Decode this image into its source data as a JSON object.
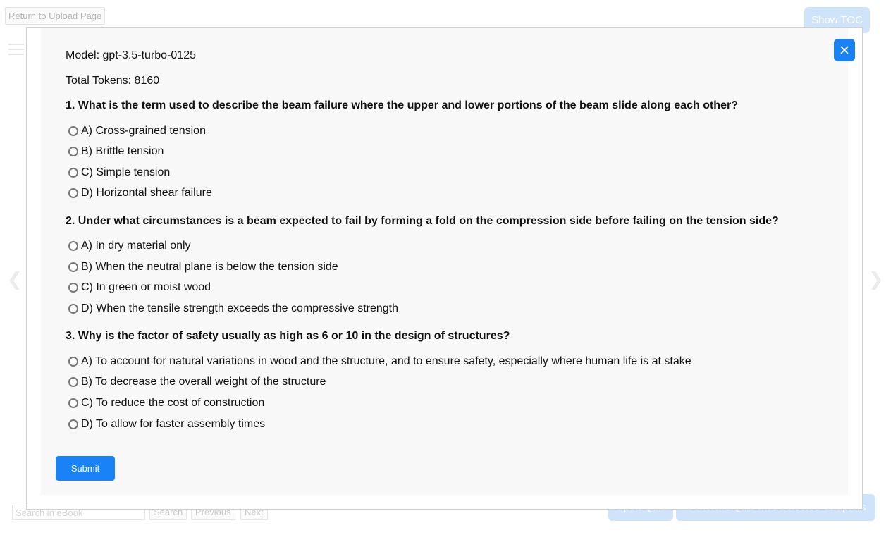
{
  "background": {
    "return_button": "Return to Upload Page",
    "toc_button": "Show TOC",
    "search_placeholder": "Search in eBook",
    "search_button": "Search",
    "previous_button": "Previous",
    "next_button": "Next",
    "open_quiz_button": "Open Quiz",
    "generate_quiz_button": "Generate Quiz with Selected Chapters",
    "prev_arrow": "❮",
    "next_arrow": "❯"
  },
  "modal": {
    "close_label": "×",
    "model_line": "Model: gpt-3.5-turbo-0125",
    "tokens_line": "Total Tokens: 8160",
    "submit_label": "Submit",
    "questions": [
      {
        "text": "1. What is the term used to describe the beam failure where the upper and lower portions of the beam slide along each other?",
        "options": [
          "A) Cross-grained tension",
          "B) Brittle tension",
          "C) Simple tension",
          "D) Horizontal shear failure"
        ]
      },
      {
        "text": "2. Under what circumstances is a beam expected to fail by forming a fold on the compression side before failing on the tension side?",
        "options": [
          "A) In dry material only",
          "B) When the neutral plane is below the tension side",
          "C) In green or moist wood",
          "D) When the tensile strength exceeds the compressive strength"
        ]
      },
      {
        "text": "3. Why is the factor of safety usually as high as 6 or 10 in the design of structures?",
        "options": [
          "A) To account for natural variations in wood and the structure, and to ensure safety, especially where human life is at stake",
          "B) To decrease the overall weight of the structure",
          "C) To reduce the cost of construction",
          "D) To allow for faster assembly times"
        ]
      }
    ]
  },
  "colors": {
    "primary": "#1a82f7",
    "faded_primary": "#cfe4fb"
  }
}
